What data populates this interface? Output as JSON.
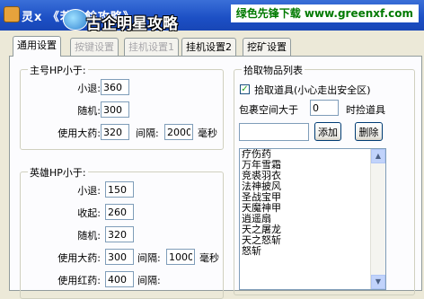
{
  "window": {
    "title": "灵x 《若三餘攻略》",
    "watermark": "古企明星攻略",
    "banner": "绿色先锋下载 www.greenxf.com"
  },
  "tabs": [
    {
      "label": "通用设置",
      "state": "active"
    },
    {
      "label": "按键设置",
      "state": "disabled"
    },
    {
      "label": "挂机设置1",
      "state": "disabled"
    },
    {
      "label": "挂机设置2",
      "state": "normal"
    },
    {
      "label": "挖矿设置",
      "state": "normal"
    }
  ],
  "main_hp": {
    "title": "主号HP小于:",
    "retreat_label": "小退:",
    "retreat_value": "360",
    "random_label": "随机:",
    "random_value": "300",
    "potion_label": "使用大药:",
    "potion_value": "320",
    "interval_label": "间隔:",
    "interval_value": "2000",
    "ms_label": "毫秒"
  },
  "hero_hp": {
    "title": "英雄HP小于:",
    "retreat_label": "小退:",
    "retreat_value": "150",
    "recall_label": "收起:",
    "recall_value": "260",
    "random_label": "随机:",
    "random_value": "320",
    "potion_label": "使用大药:",
    "potion_value": "300",
    "interval_label": "间隔:",
    "interval_value": "1000",
    "ms_label": "毫秒",
    "red_label": "使用红药:",
    "red_value": "400",
    "red_interval_label": "间隔:"
  },
  "pickup": {
    "title": "拾取物品列表",
    "checkbox_label": "拾取道具(小心走出安全区)",
    "checkbox_checked": true,
    "space_label": "包裹空间大于",
    "space_value": "0",
    "pickup_suffix": "时捡道具",
    "add_input": "",
    "add_button": "添加",
    "delete_button": "删除",
    "items": [
      "疗伤药",
      "万年雪霜",
      "竞裘羽衣",
      "法神披风",
      "圣战宝甲",
      "天魔神甲",
      "逍遥扇",
      "天之屠龙",
      "天之怒斩",
      "怒斩"
    ]
  }
}
